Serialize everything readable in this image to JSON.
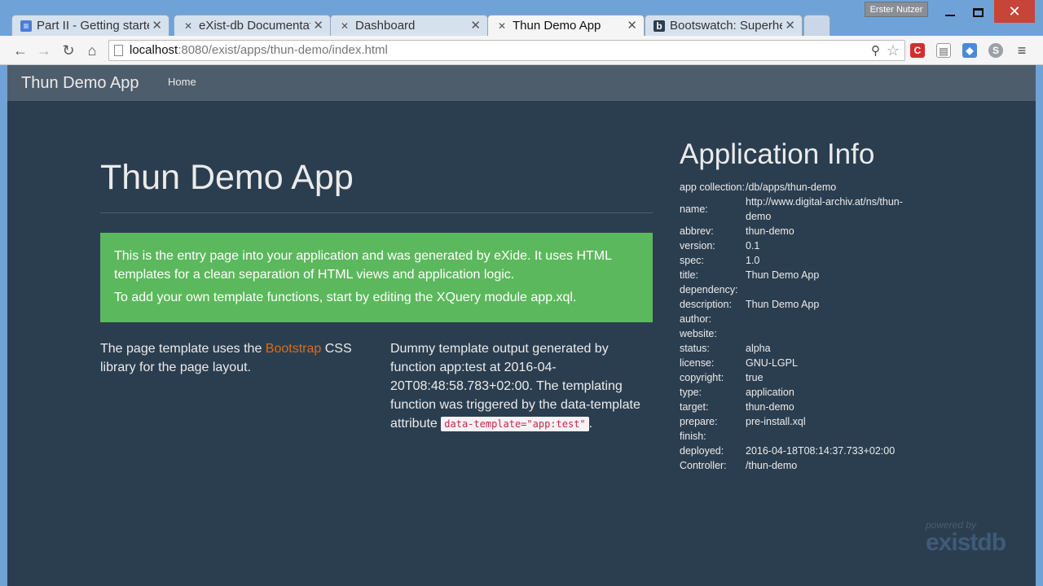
{
  "window": {
    "user": "Erster Nutzer"
  },
  "tabs": [
    {
      "label": "Part II - Getting started",
      "icon": "document-icon",
      "active": false
    },
    {
      "label": "eXist-db Documentation",
      "icon": "exist-icon",
      "active": false
    },
    {
      "label": "Dashboard",
      "icon": "exist-icon",
      "active": false
    },
    {
      "label": "Thun Demo App",
      "icon": "exist-icon",
      "active": true
    },
    {
      "label": "Bootswatch: Superhero",
      "icon": "bootswatch-icon",
      "active": false
    }
  ],
  "address": {
    "host": "localhost",
    "path": ":8080/exist/apps/thun-demo/index.html"
  },
  "navbar": {
    "brand": "Thun Demo App",
    "home": "Home"
  },
  "main": {
    "title": "Thun Demo App",
    "alert_line1": "This is the entry page into your application and was generated by eXide. It uses HTML templates for a clean separation of HTML views and application logic.",
    "alert_line2": "To add your own template functions, start by editing the XQuery module app.xql.",
    "left_before": "The page template uses the ",
    "left_link": "Bootstrap",
    "left_after": " CSS library for the page layout.",
    "mid_text": "Dummy template output generated by function app:test at 2016-04-20T08:48:58.783+02:00. The templating function was triggered by the data-template attribute ",
    "mid_code": "data-template=\"app:test\"",
    "mid_end": "."
  },
  "info": {
    "title": "Application Info",
    "rows": [
      {
        "k": "app collection:",
        "v": "/db/apps/thun-demo"
      },
      {
        "k": "name:",
        "v": "http://www.digital-archiv.at/ns/thun-demo"
      },
      {
        "k": "abbrev:",
        "v": "thun-demo"
      },
      {
        "k": "version:",
        "v": "0.1"
      },
      {
        "k": "spec:",
        "v": "1.0"
      },
      {
        "k": "title:",
        "v": "Thun Demo App"
      },
      {
        "k": "dependency:",
        "v": ""
      },
      {
        "k": "description:",
        "v": "Thun Demo App"
      },
      {
        "k": "author:",
        "v": ""
      },
      {
        "k": "website:",
        "v": ""
      },
      {
        "k": "status:",
        "v": "alpha"
      },
      {
        "k": "license:",
        "v": "GNU-LGPL"
      },
      {
        "k": "copyright:",
        "v": "true"
      },
      {
        "k": "type:",
        "v": "application"
      },
      {
        "k": "target:",
        "v": "thun-demo"
      },
      {
        "k": "prepare:",
        "v": "pre-install.xql"
      },
      {
        "k": "finish:",
        "v": ""
      },
      {
        "k": "deployed:",
        "v": "2016-04-18T08:14:37.733+02:00"
      },
      {
        "k": "Controller:",
        "v": "/thun-demo"
      }
    ]
  },
  "footer": {
    "powered_by": "powered by",
    "logo": "existdb"
  },
  "colors": {
    "page_bg": "#2b3e50",
    "navbar_bg": "#4e5d6c",
    "alert_bg": "#5cb85c",
    "link": "#df691a"
  }
}
